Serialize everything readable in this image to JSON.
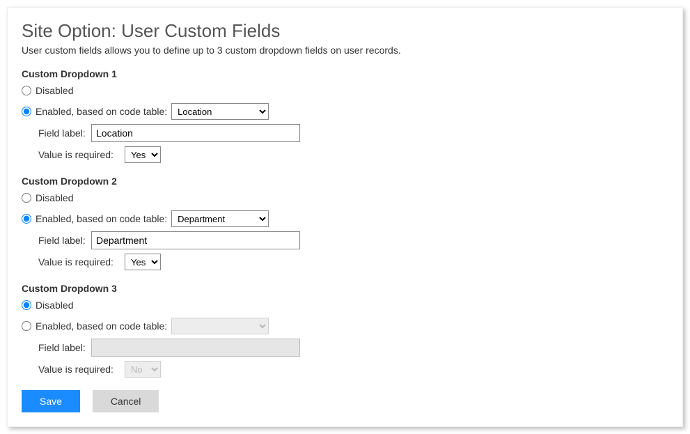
{
  "page": {
    "title": "Site Option: User Custom Fields",
    "description": "User custom fields allows you to define up to 3 custom dropdown fields on user records."
  },
  "labels": {
    "disabled": "Disabled",
    "enabled_prefix": "Enabled, based on code table:",
    "field_label": "Field label:",
    "value_required": "Value is required:"
  },
  "sections": [
    {
      "title": "Custom Dropdown 1",
      "state": "enabled",
      "code_table": "Location",
      "field_label_value": "Location",
      "required": "Yes",
      "disabled_controls": false
    },
    {
      "title": "Custom Dropdown 2",
      "state": "enabled",
      "code_table": "Department",
      "field_label_value": "Department",
      "required": "Yes",
      "disabled_controls": false
    },
    {
      "title": "Custom Dropdown 3",
      "state": "disabled",
      "code_table": "",
      "field_label_value": "",
      "required": "No",
      "disabled_controls": true
    }
  ],
  "buttons": {
    "save": "Save",
    "cancel": "Cancel"
  }
}
